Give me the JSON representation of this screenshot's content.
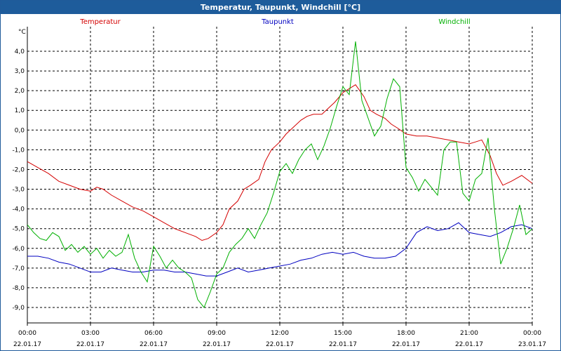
{
  "window": {
    "title": "Temperatur, Taupunkt, Windchill [°C]"
  },
  "chart_data": {
    "type": "line",
    "title": "Temperatur, Taupunkt, Windchill [°C]",
    "ylabel": "°C",
    "ylim": [
      -10,
      5
    ],
    "xlim": [
      0,
      24
    ],
    "grid": true,
    "legend": "top",
    "y_ticks": [
      "4,0",
      "3,0",
      "2,0",
      "1,0",
      "0,0",
      "-1,0",
      "-2,0",
      "-3,0",
      "-4,0",
      "-5,0",
      "-6,0",
      "-7,0",
      "-8,0",
      "-9,0"
    ],
    "y_tick_values": [
      4,
      3,
      2,
      1,
      0,
      -1,
      -2,
      -3,
      -4,
      -5,
      -6,
      -7,
      -8,
      -9
    ],
    "x_ticks": [
      {
        "time": "00:00",
        "date": "22.01.17",
        "hour": 0
      },
      {
        "time": "03:00",
        "date": "22.01.17",
        "hour": 3
      },
      {
        "time": "06:00",
        "date": "22.01.17",
        "hour": 6
      },
      {
        "time": "09:00",
        "date": "22.01.17",
        "hour": 9
      },
      {
        "time": "12:00",
        "date": "22.01.17",
        "hour": 12
      },
      {
        "time": "15:00",
        "date": "22.01.17",
        "hour": 15
      },
      {
        "time": "18:00",
        "date": "22.01.17",
        "hour": 18
      },
      {
        "time": "21:00",
        "date": "22.01.17",
        "hour": 21
      },
      {
        "time": "00:00",
        "date": "23.01.17",
        "hour": 24
      }
    ],
    "series": [
      {
        "name": "Temperatur",
        "color": "#d40000",
        "x": [
          0,
          0.5,
          1,
          1.5,
          2,
          2.5,
          3,
          3.3,
          3.6,
          4,
          4.5,
          5,
          5.5,
          6,
          6.5,
          7,
          7.5,
          8,
          8.3,
          8.6,
          9,
          9.3,
          9.6,
          10,
          10.3,
          10.6,
          11,
          11.3,
          11.6,
          12,
          12.3,
          12.6,
          13,
          13.3,
          13.6,
          14,
          14.3,
          14.6,
          15,
          15.3,
          15.6,
          16,
          16.3,
          16.6,
          17,
          17.3,
          17.6,
          18,
          18.5,
          19,
          19.5,
          20,
          20.5,
          21,
          21.3,
          21.6,
          22,
          22.3,
          22.6,
          23,
          23.5,
          24
        ],
        "y": [
          -1.6,
          -1.9,
          -2.2,
          -2.6,
          -2.8,
          -3.0,
          -3.1,
          -2.9,
          -3.0,
          -3.3,
          -3.6,
          -3.9,
          -4.1,
          -4.4,
          -4.7,
          -5.0,
          -5.2,
          -5.4,
          -5.6,
          -5.5,
          -5.2,
          -4.8,
          -4.0,
          -3.6,
          -3.0,
          -2.8,
          -2.5,
          -1.6,
          -1.0,
          -0.6,
          -0.2,
          0.1,
          0.5,
          0.7,
          0.8,
          0.8,
          1.1,
          1.4,
          1.9,
          2.1,
          2.3,
          1.7,
          1.0,
          0.8,
          0.6,
          0.3,
          0.1,
          -0.2,
          -0.3,
          -0.3,
          -0.4,
          -0.5,
          -0.6,
          -0.7,
          -0.6,
          -0.5,
          -1.3,
          -2.2,
          -2.8,
          -2.6,
          -2.3,
          -2.7
        ]
      },
      {
        "name": "Taupunkt",
        "color": "#0000c0",
        "x": [
          0,
          0.5,
          1,
          1.5,
          2,
          2.5,
          3,
          3.5,
          4,
          4.5,
          5,
          5.5,
          6,
          6.5,
          7,
          7.5,
          8,
          8.5,
          9,
          9.5,
          10,
          10.5,
          11,
          11.5,
          12,
          12.5,
          13,
          13.5,
          14,
          14.5,
          15,
          15.5,
          16,
          16.5,
          17,
          17.5,
          18,
          18.5,
          19,
          19.5,
          20,
          20.5,
          21,
          21.5,
          22,
          22.5,
          23,
          23.5,
          24
        ],
        "y": [
          -6.4,
          -6.4,
          -6.5,
          -6.7,
          -6.8,
          -7.0,
          -7.2,
          -7.2,
          -7.0,
          -7.1,
          -7.2,
          -7.2,
          -7.1,
          -7.1,
          -7.2,
          -7.2,
          -7.3,
          -7.4,
          -7.4,
          -7.2,
          -7.0,
          -7.2,
          -7.1,
          -7.0,
          -6.9,
          -6.8,
          -6.6,
          -6.5,
          -6.3,
          -6.2,
          -6.3,
          -6.2,
          -6.4,
          -6.5,
          -6.5,
          -6.4,
          -6.0,
          -5.2,
          -4.9,
          -5.1,
          -5.0,
          -4.7,
          -5.2,
          -5.3,
          -5.4,
          -5.2,
          -4.9,
          -4.8,
          -5.0
        ]
      },
      {
        "name": "Windchill",
        "color": "#00b000",
        "x": [
          0,
          0.3,
          0.6,
          0.9,
          1.2,
          1.5,
          1.8,
          2.1,
          2.4,
          2.7,
          3,
          3.3,
          3.6,
          3.9,
          4.2,
          4.5,
          4.8,
          5.1,
          5.4,
          5.7,
          6,
          6.3,
          6.6,
          6.9,
          7.2,
          7.5,
          7.8,
          8.1,
          8.4,
          8.7,
          9,
          9.3,
          9.6,
          9.9,
          10.2,
          10.5,
          10.8,
          11.1,
          11.4,
          11.7,
          12,
          12.3,
          12.6,
          12.9,
          13.2,
          13.5,
          13.8,
          14.1,
          14.4,
          14.7,
          15,
          15.3,
          15.6,
          15.9,
          16.2,
          16.5,
          16.8,
          17.1,
          17.4,
          17.7,
          18,
          18.3,
          18.6,
          18.9,
          19.2,
          19.5,
          19.8,
          20.1,
          20.4,
          20.7,
          21,
          21.3,
          21.6,
          21.9,
          22.2,
          22.5,
          22.8,
          23.1,
          23.4,
          23.7,
          24
        ],
        "y": [
          -4.8,
          -5.2,
          -5.5,
          -5.6,
          -5.2,
          -5.4,
          -6.1,
          -5.8,
          -6.2,
          -5.9,
          -6.3,
          -6.0,
          -6.5,
          -6.1,
          -6.4,
          -6.2,
          -5.3,
          -6.5,
          -7.2,
          -7.7,
          -5.9,
          -6.4,
          -7.0,
          -6.6,
          -7.0,
          -7.2,
          -7.5,
          -8.6,
          -9.0,
          -8.2,
          -7.3,
          -7.0,
          -6.2,
          -5.8,
          -5.5,
          -5.0,
          -5.5,
          -4.8,
          -4.2,
          -3.2,
          -2.1,
          -1.7,
          -2.2,
          -1.5,
          -1.0,
          -0.7,
          -1.5,
          -0.8,
          0.1,
          1.2,
          2.2,
          1.8,
          4.5,
          1.5,
          0.6,
          -0.3,
          0.2,
          1.6,
          2.6,
          2.2,
          -1.9,
          -2.4,
          -3.1,
          -2.5,
          -2.9,
          -3.3,
          -1.0,
          -0.6,
          -0.6,
          -3.2,
          -3.6,
          -2.5,
          -2.2,
          -0.4,
          -4.0,
          -6.8,
          -6.0,
          -5.0,
          -3.8,
          -5.3,
          -5.0
        ]
      }
    ]
  }
}
